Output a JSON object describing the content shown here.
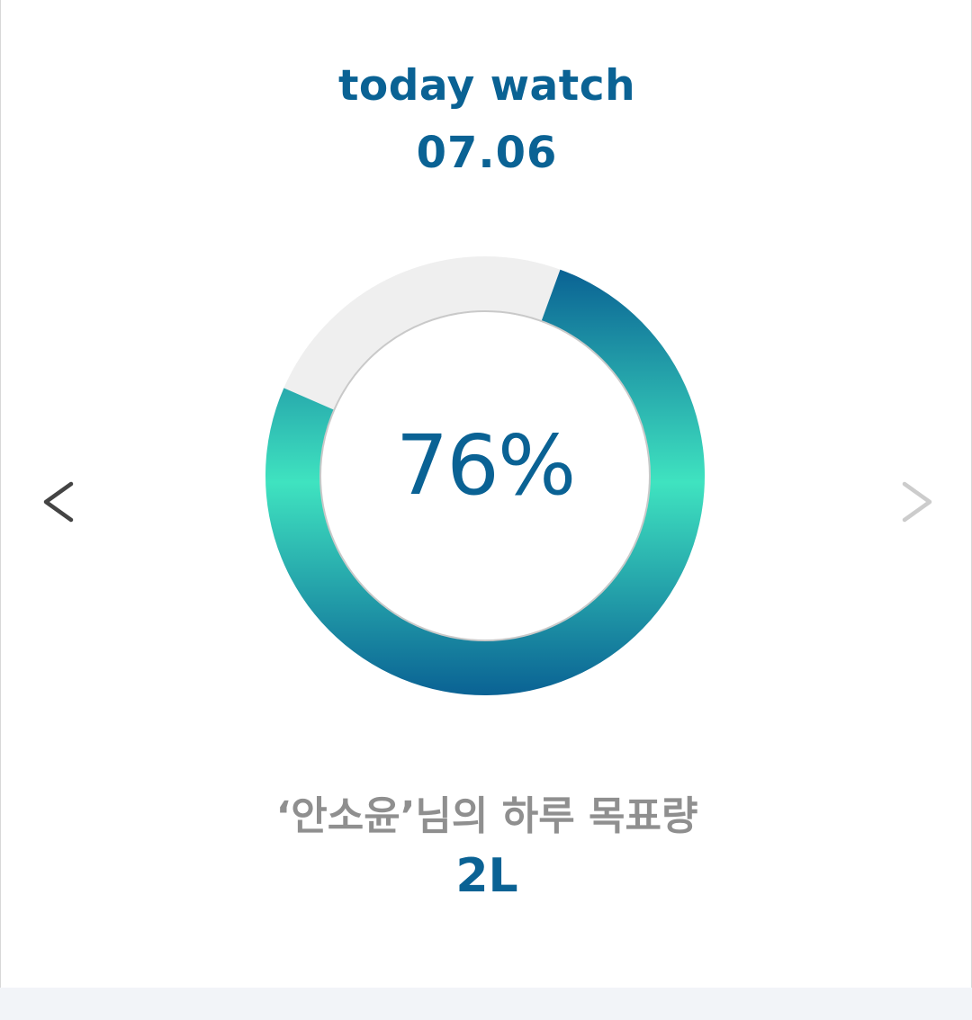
{
  "header": {
    "title": "today watch",
    "date": "07.06"
  },
  "progress": {
    "percent_label": "76%",
    "fraction": 0.76,
    "colors": {
      "gradient_start": "#0a6294",
      "gradient_mid": "#3fe3c0",
      "track": "#efefef",
      "inner_border": "#c9c9c9",
      "text": "#0a6294"
    }
  },
  "navigation": {
    "prev_icon": "chevron-left-icon",
    "next_icon": "chevron-right-icon",
    "prev_color": "#444444",
    "next_color": "#cccccc"
  },
  "goal": {
    "label": "‘안소윤’님의 하루 목표량",
    "value": "2L"
  }
}
